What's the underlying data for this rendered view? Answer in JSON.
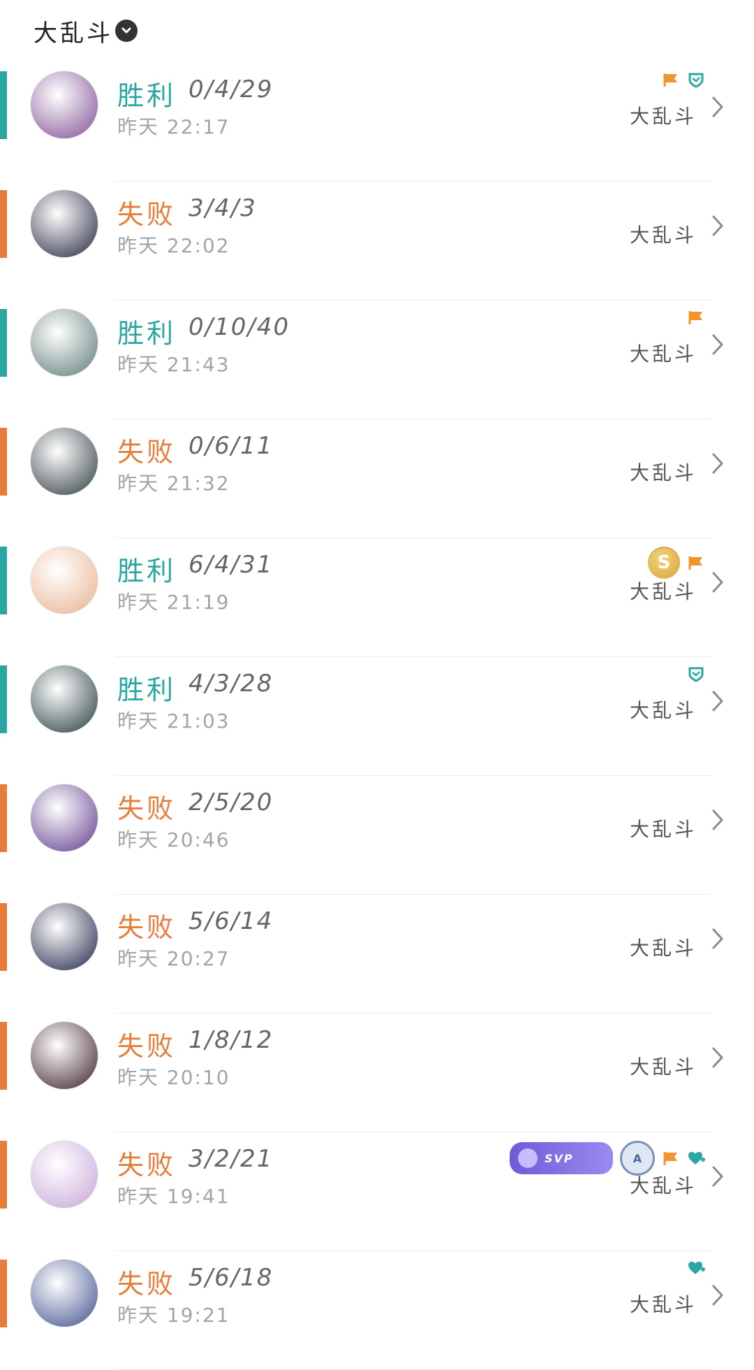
{
  "header": {
    "title": "大乱斗"
  },
  "colors": {
    "win": "#2aa7a0",
    "loss": "#e77d3a",
    "accent_win": "#2aa7a0",
    "accent_loss": "#e77d3a"
  },
  "matches": [
    {
      "result": "胜利",
      "kda": "0/4/29",
      "time": "昨天 22:17",
      "mode": "大乱斗",
      "icons": [
        "flag-icon",
        "shield-icon"
      ],
      "avatar_color": "#7e4d92"
    },
    {
      "result": "失败",
      "kda": "3/4/3",
      "time": "昨天 22:02",
      "mode": "大乱斗",
      "icons": [],
      "avatar_color": "#23253d"
    },
    {
      "result": "胜利",
      "kda": "0/10/40",
      "time": "昨天 21:43",
      "mode": "大乱斗",
      "icons": [
        "flag-icon"
      ],
      "avatar_color": "#5c7b77"
    },
    {
      "result": "失败",
      "kda": "0/6/11",
      "time": "昨天 21:32",
      "mode": "大乱斗",
      "icons": [],
      "avatar_color": "#2d3a3e"
    },
    {
      "result": "胜利",
      "kda": "6/4/31",
      "time": "昨天 21:19",
      "mode": "大乱斗",
      "icons": [
        "coin-icon",
        "flag-icon"
      ],
      "avatar_color": "#e7b18e"
    },
    {
      "result": "胜利",
      "kda": "4/3/28",
      "time": "昨天 21:03",
      "mode": "大乱斗",
      "icons": [
        "shield-icon"
      ],
      "avatar_color": "#243a3b"
    },
    {
      "result": "失败",
      "kda": "2/5/20",
      "time": "昨天 20:46",
      "mode": "大乱斗",
      "icons": [],
      "avatar_color": "#5e3a8b"
    },
    {
      "result": "失败",
      "kda": "5/6/14",
      "time": "昨天 20:27",
      "mode": "大乱斗",
      "icons": [],
      "avatar_color": "#1f2346"
    },
    {
      "result": "失败",
      "kda": "1/8/12",
      "time": "昨天 20:10",
      "mode": "大乱斗",
      "icons": [],
      "avatar_color": "#3a1e25"
    },
    {
      "result": "失败",
      "kda": "3/2/21",
      "time": "昨天 19:41",
      "mode": "大乱斗",
      "icons": [
        "svp-badge",
        "a-badge",
        "flag-icon",
        "heart-plus-icon"
      ],
      "svp_label": "SVP",
      "a_label": "A",
      "avatar_color": "#c6a4d7"
    },
    {
      "result": "失败",
      "kda": "5/6/18",
      "time": "昨天 19:21",
      "mode": "大乱斗",
      "icons": [
        "heart-plus-icon"
      ],
      "avatar_color": "#3e4f8b"
    }
  ]
}
